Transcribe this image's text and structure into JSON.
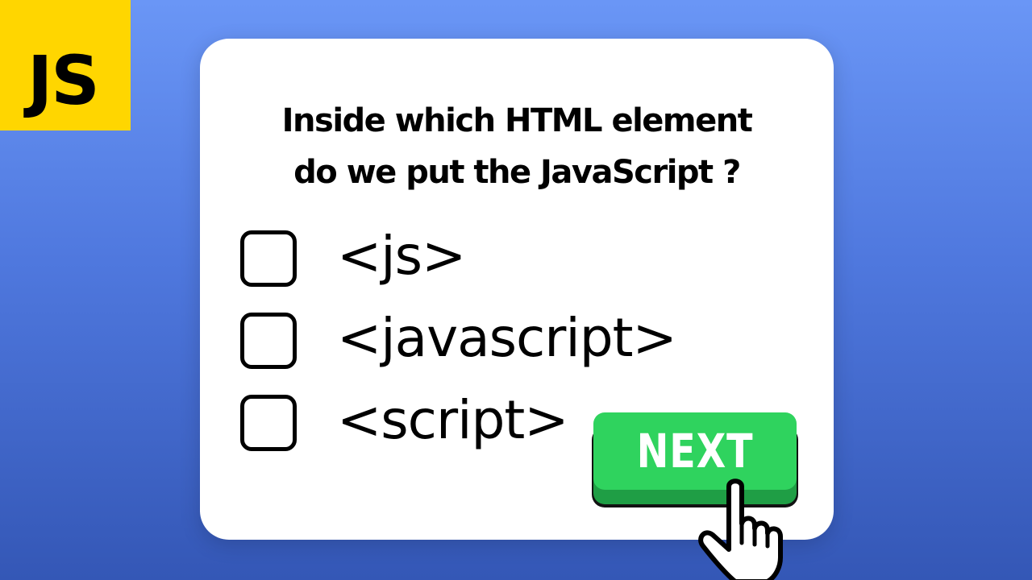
{
  "logo": {
    "text": "JS",
    "color": "#ffd600"
  },
  "quiz": {
    "question_lines": [
      "Inside which HTML element",
      "do we put the JavaScript ?"
    ],
    "options": [
      {
        "label": "<js>",
        "checked": false
      },
      {
        "label": "<javascript>",
        "checked": false
      },
      {
        "label": "<script>",
        "checked": false
      }
    ],
    "next_label": "NEXT"
  },
  "colors": {
    "background_top": "#6a96f6",
    "background_bottom": "#3457b6",
    "card": "#ffffff",
    "button_face": "#2fd35e",
    "button_edge": "#1f9e45",
    "text": "#000000"
  },
  "icons": {
    "cursor": "pointing-hand-icon",
    "checkbox": "empty-checkbox-icon"
  }
}
